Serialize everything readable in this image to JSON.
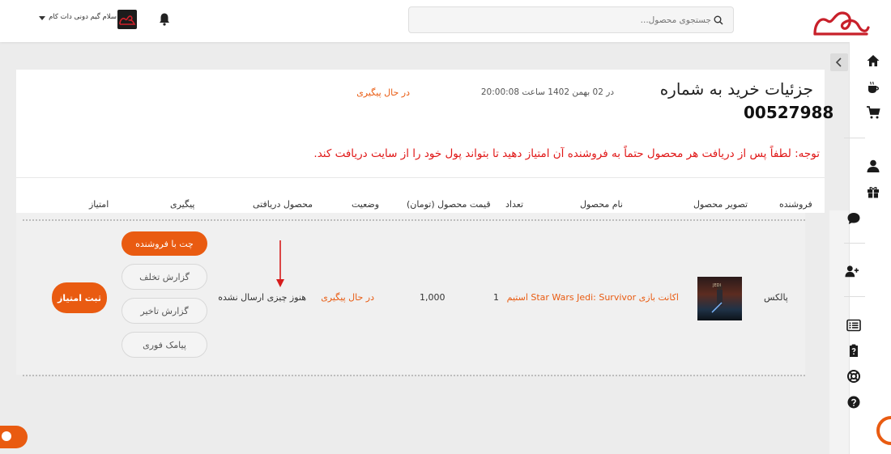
{
  "header": {
    "search_placeholder": "جستجوی محصول...",
    "user_greeting": "سلام گیم دونی دات کام"
  },
  "order": {
    "title_line1": "جزئیات خرید به شماره",
    "order_number": "00527988",
    "date_text": "در 02 بهمن 1402 ساعت 20:00:08",
    "status": "در حال پیگیری",
    "notice": "توجه: لطفاً پس از دریافت هر محصول حتماً به فروشنده آن امتیاز دهید تا بتواند پول خود را از سایت دریافت کند."
  },
  "table": {
    "headers": [
      "فروشنده",
      "تصویر محصول",
      "نام محصول",
      "تعداد",
      "قیمت محصول (تومان)",
      "وضعیت",
      "محصول دریافتی",
      "پیگیری",
      "امتیاز"
    ],
    "row": {
      "seller": "پالکس",
      "product_name": "اکانت بازی Star Wars Jedi: Survivor استیم",
      "quantity": "1",
      "price": "1,000",
      "status": "در حال پیگیری",
      "received": "هنوز چیزی ارسال نشده",
      "actions": [
        "چت با فروشنده",
        "گزارش تخلف",
        "گزارش تاخیر",
        "پیامک فوری"
      ],
      "rate_button": "ثبت امتیاز"
    }
  },
  "colors": {
    "accent": "#e95b11",
    "notice": "#e01717",
    "logo": "#c8202a"
  },
  "sidebar_icons": [
    "home-icon",
    "coffee-icon",
    "cart-icon",
    "user-icon",
    "gift-icon",
    "chat-icon",
    "add-user-icon",
    "list-icon",
    "clipboard-question-icon",
    "lifebuoy-icon",
    "help-icon"
  ]
}
